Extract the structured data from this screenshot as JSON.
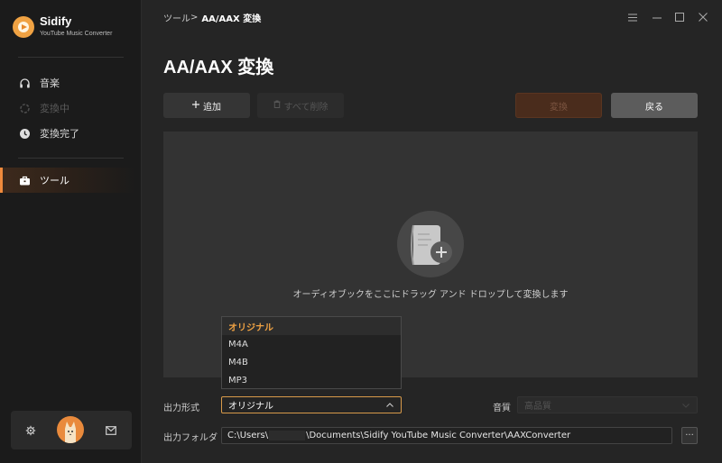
{
  "app": {
    "name": "Sidify",
    "subtitle": "YouTube Music Converter"
  },
  "sidebar": {
    "items": [
      {
        "label": "音楽",
        "icon": "headphones-icon",
        "state": "normal"
      },
      {
        "label": "変換中",
        "icon": "spinner-icon",
        "state": "disabled"
      },
      {
        "label": "変換完了",
        "icon": "clock-icon",
        "state": "normal"
      },
      {
        "label": "ツール",
        "icon": "toolbox-icon",
        "state": "active"
      }
    ],
    "footer": {
      "settings_icon": "gear-icon",
      "avatar_icon": "avatar-icon",
      "mail_icon": "mail-icon"
    }
  },
  "header": {
    "breadcrumb_parent": "ツール",
    "breadcrumb_sep": ">",
    "breadcrumb_current": "AA/AAX 変換",
    "window_controls": [
      "menu-icon",
      "minimize-icon",
      "maximize-icon",
      "close-icon"
    ]
  },
  "page": {
    "title": "AA/AAX 変換"
  },
  "toolbar": {
    "add_label": "追加",
    "delete_all_label": "すべて削除",
    "convert_label": "変換",
    "back_label": "戻る"
  },
  "dropzone": {
    "text": "オーディオブックをここにドラッグ アンド ドロップして変換します"
  },
  "settings": {
    "format_label": "出力形式",
    "format_value": "オリジナル",
    "format_options": [
      "オリジナル",
      "M4A",
      "M4B",
      "MP3"
    ],
    "quality_label": "音質",
    "quality_value": "高品質",
    "folder_label": "出力フォルダ",
    "folder_prefix": "C:\\Users\\",
    "folder_suffix": "\\Documents\\Sidify YouTube Music Converter\\AAXConverter",
    "browse_label": "···"
  },
  "colors": {
    "accent": "#f08a3c",
    "selected_option": "#f0a243",
    "sidebar_bg": "#1b1b1b",
    "main_bg": "#252525"
  }
}
